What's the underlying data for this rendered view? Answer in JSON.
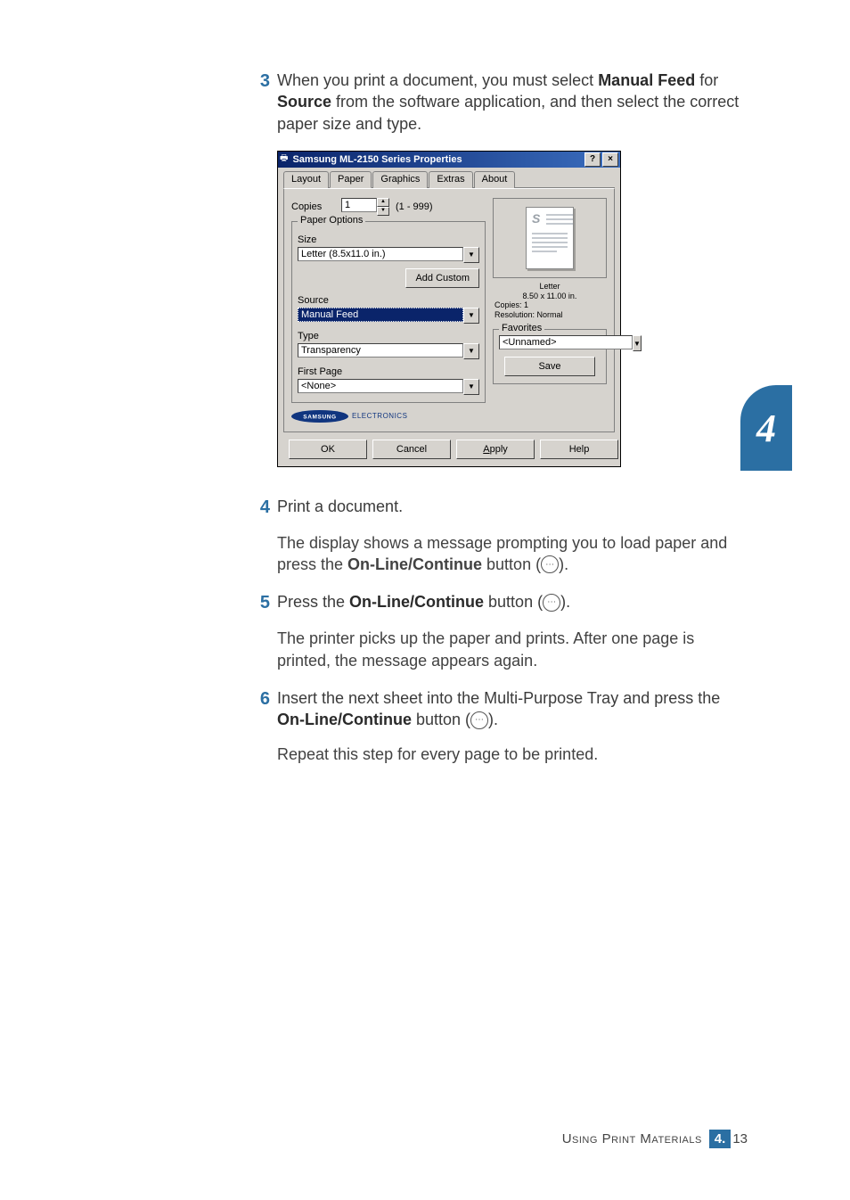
{
  "steps": {
    "s3": {
      "num": "3",
      "text_a": "When you print a document, you must select ",
      "b1": "Manual Feed",
      "text_b": " for ",
      "b2": "Source",
      "text_c": " from the software application, and then select the correct paper size and type."
    },
    "s4": {
      "num": "4",
      "text": "Print a document.",
      "sub_a": "The display shows a message prompting you to load paper and press the ",
      "b": "On-Line/Continue",
      "sub_b": " button (",
      "sub_c": ")."
    },
    "s5": {
      "num": "5",
      "text_a": "Press the ",
      "b": "On-Line/Continue",
      "text_b": " button (",
      "text_c": ").",
      "sub": "The printer picks up the paper and prints. After one page is printed, the message appears again."
    },
    "s6": {
      "num": "6",
      "text_a": "Insert the next sheet into the Multi-Purpose Tray and press the ",
      "b": "On-Line/Continue",
      "text_b": " button (",
      "text_c": ").",
      "sub": "Repeat this step for every page to be printed."
    }
  },
  "dialog": {
    "title": "Samsung ML-2150 Series Properties",
    "tabs": [
      "Layout",
      "Paper",
      "Graphics",
      "Extras",
      "About"
    ],
    "active_tab": "Paper",
    "copies_label": "Copies",
    "copies_value": "1",
    "copies_range": "(1 - 999)",
    "paper_options": "Paper Options",
    "size_label": "Size",
    "size_value": "Letter (8.5x11.0 in.)",
    "add_custom": "Add Custom",
    "source_label": "Source",
    "source_value": "Manual Feed",
    "type_label": "Type",
    "type_value": "Transparency",
    "firstpage_label": "First Page",
    "firstpage_value": "<None>",
    "preview": {
      "line1": "Letter",
      "line2": "8.50 x 11.00 in.",
      "line3": "Copies: 1",
      "line4": "Resolution: Normal"
    },
    "favorites_label": "Favorites",
    "favorites_value": "<Unnamed>",
    "save": "Save",
    "brand": "ELECTRONICS",
    "ok": "OK",
    "cancel": "Cancel",
    "apply": "Apply",
    "help": "Help"
  },
  "side_tab": "4",
  "footer": {
    "cap": "Using Print Materials",
    "chapter": "4.",
    "page": "13"
  }
}
